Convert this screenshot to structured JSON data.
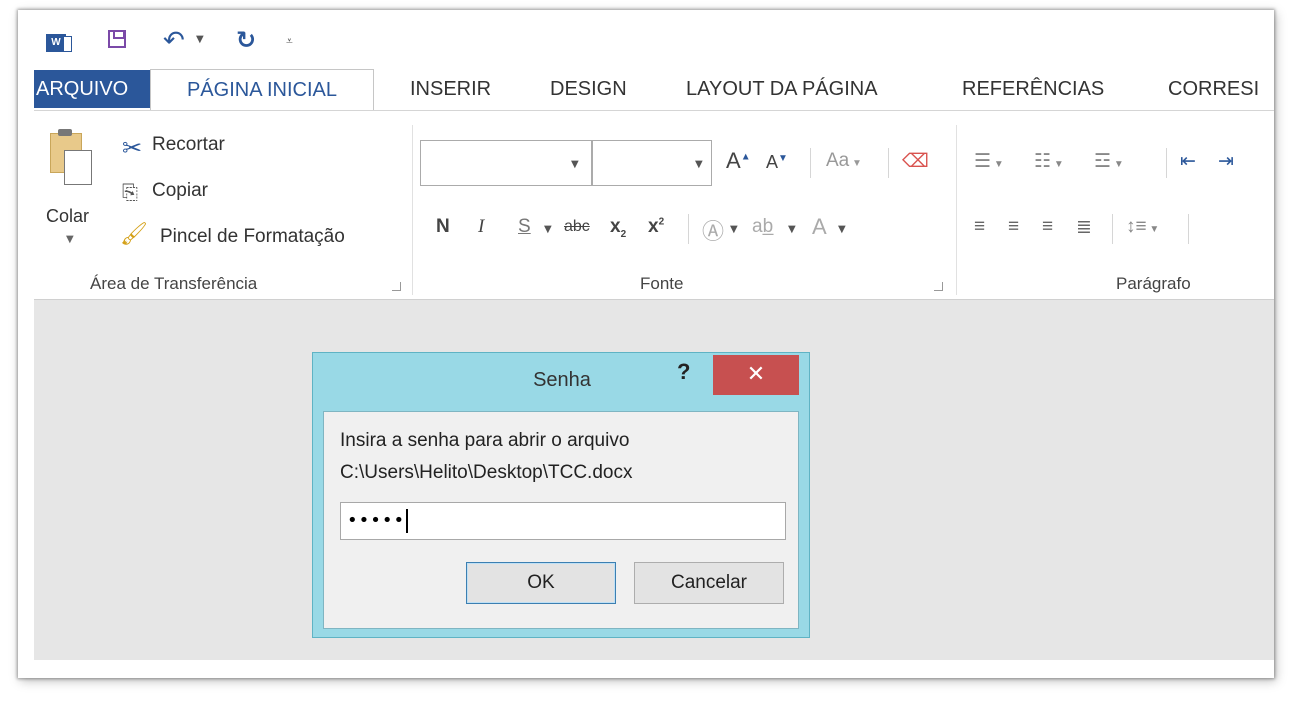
{
  "quick_access": {
    "app_icon": "word-icon",
    "save_icon": "save-icon",
    "undo_icon": "undo-icon",
    "redo_icon": "redo-icon",
    "customize_icon": "customize-qat-icon"
  },
  "tabs": [
    {
      "label": "ARQUIVO"
    },
    {
      "label": "PÁGINA INICIAL"
    },
    {
      "label": "INSERIR"
    },
    {
      "label": "DESIGN"
    },
    {
      "label": "LAYOUT DA PÁGINA"
    },
    {
      "label": "REFERÊNCIAS"
    },
    {
      "label": "CORRESI"
    }
  ],
  "clipboard": {
    "paste_label": "Colar",
    "cut_label": "Recortar",
    "copy_label": "Copiar",
    "format_painter_label": "Pincel de Formatação",
    "group_label": "Área de Transferência"
  },
  "font": {
    "font_name": "",
    "font_size": "",
    "bold": "N",
    "italic": "I",
    "underline": "S",
    "strike": "abc",
    "subscript": "x",
    "superscript": "x",
    "change_case": "Aa",
    "group_label": "Fonte"
  },
  "paragraph": {
    "group_label": "Parágrafo"
  },
  "dialog": {
    "title": "Senha",
    "help": "?",
    "close": "✕",
    "prompt": "Insira a senha para abrir o arquivo",
    "path": "C:\\Users\\Helito\\Desktop\\TCC.docx",
    "password_value": "•••••",
    "ok_label": "OK",
    "cancel_label": "Cancelar"
  },
  "colors": {
    "brand": "#2b579a",
    "dialog_frame": "#99d9e6",
    "close_button": "#c75050"
  }
}
